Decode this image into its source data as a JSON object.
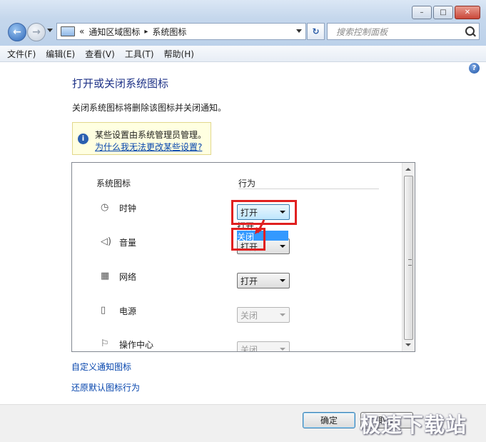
{
  "window": {
    "caption_buttons": {
      "minimize": "–",
      "maximize": "□",
      "close": "✕"
    }
  },
  "address_bar": {
    "chevron": "«",
    "crumbs": [
      "通知区域图标",
      "系统图标"
    ],
    "separator": "▸"
  },
  "search": {
    "placeholder": "搜索控制面板"
  },
  "menu": [
    "文件(F)",
    "编辑(E)",
    "查看(V)",
    "工具(T)",
    "帮助(H)"
  ],
  "page": {
    "title": "打开或关闭系统图标",
    "description": "关闭系统图标将删除该图标并关闭通知。"
  },
  "info": {
    "text": "某些设置由系统管理员管理。",
    "link": "为什么我无法更改某些设置?"
  },
  "table": {
    "col_icons": "系统图标",
    "col_behavior": "行为",
    "rows": [
      {
        "label": "时钟",
        "icon": "clock-icon",
        "value": "打开",
        "enabled": true
      },
      {
        "label": "音量",
        "icon": "volume-icon",
        "value": "打开",
        "enabled": true
      },
      {
        "label": "网络",
        "icon": "network-icon",
        "value": "打开",
        "enabled": true
      },
      {
        "label": "电源",
        "icon": "power-icon",
        "value": "关闭",
        "enabled": false
      },
      {
        "label": "操作中心",
        "icon": "flag-icon",
        "value": "关闭",
        "enabled": false
      }
    ],
    "dropdown_options": [
      "打开",
      "关闭"
    ],
    "dropdown_selected": "关闭"
  },
  "links": {
    "customize": "自定义通知图标",
    "restore": "还原默认图标行为"
  },
  "buttons": {
    "ok": "确定",
    "cancel": "取消"
  },
  "watermark": "极速下载站",
  "colors": {
    "highlight": "#3399ff",
    "annotation": "#e02020",
    "title": "#1e3287",
    "link": "#0645ad"
  }
}
